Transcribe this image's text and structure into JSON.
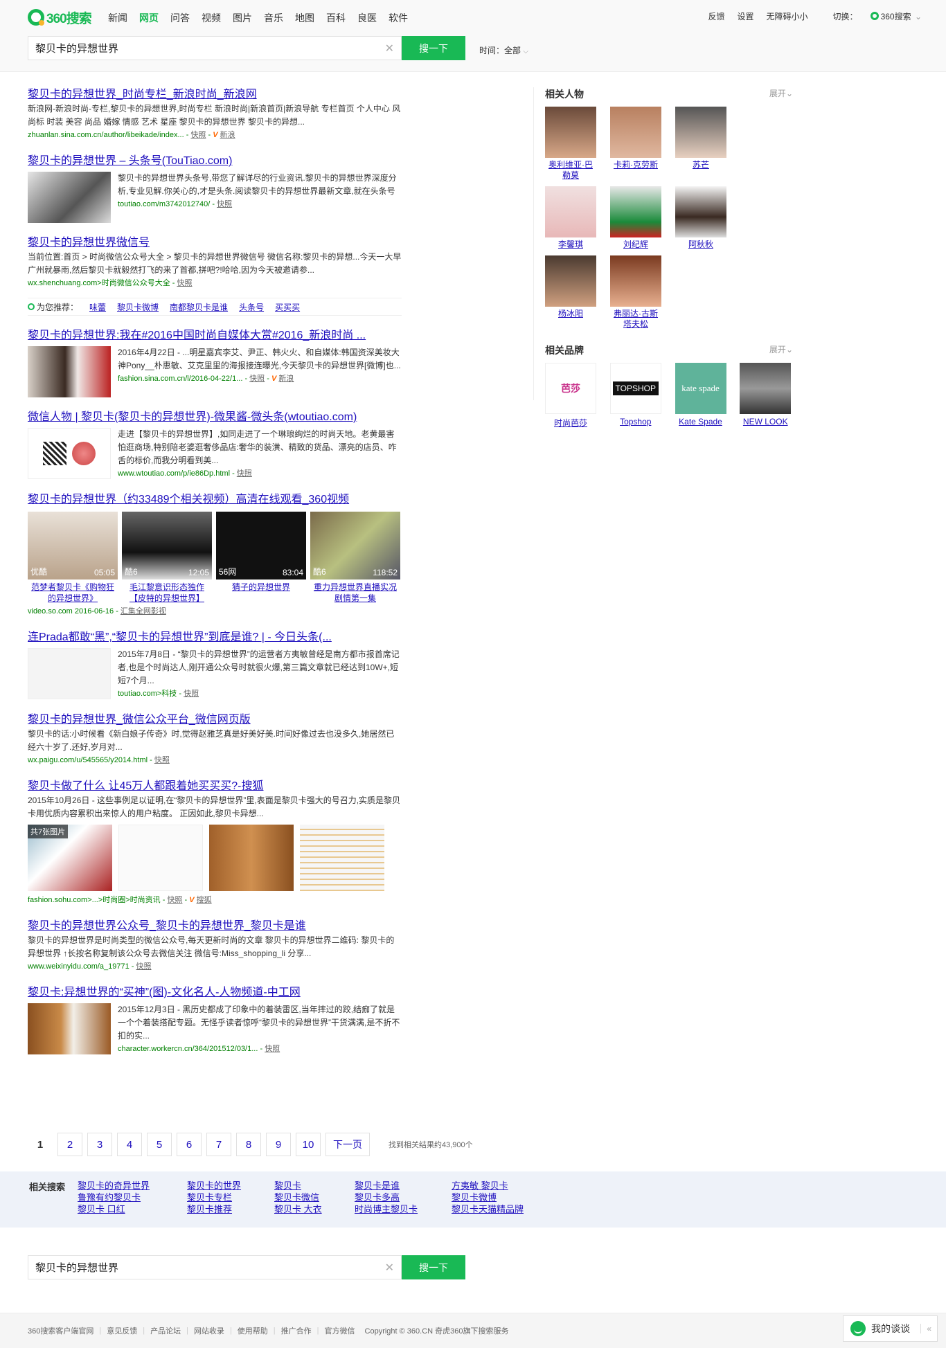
{
  "brand": {
    "name": "360搜索"
  },
  "nav": [
    "新闻",
    "网页",
    "问答",
    "视频",
    "图片",
    "音乐",
    "地图",
    "百科",
    "良医",
    "软件"
  ],
  "nav_active": "网页",
  "toplinks": {
    "feedback": "反馈",
    "settings": "设置",
    "barrier_free": "无障碍小小",
    "switch": "切换：",
    "switch_target": "360搜索"
  },
  "search": {
    "query": "黎贝卡的异想世界",
    "button": "搜一下",
    "time_label": "时间：",
    "time_value": "全部"
  },
  "results": [
    {
      "title": "黎贝卡的异想世界_时尚专栏_新浪时尚_新浪网",
      "desc": "新浪网-新浪时尚-专栏,黎贝卡的异想世界,时尚专栏 新浪时尚|新浪首页|新浪导航 专栏首页 个人中心 风尚标 时装 美容 尚品 婚嫁 情感 艺术 星座 黎贝卡的异想世界 黎贝卡的异想...",
      "url": "zhuanlan.sina.com.cn/author/libeikade/index...",
      "snap": "快照",
      "site": "新浪"
    },
    {
      "title": "黎贝卡的异想世界 – 头条号(TouTiao.com)",
      "desc": "黎贝卡的异想世界头条号,带您了解详尽的行业资讯.黎贝卡的异想世界深度分析,专业见解.你关心的,才是头条.阅读黎贝卡的异想世界最新文章,就在头条号",
      "url": "toutiao.com/m3742012740/",
      "snap": "快照"
    },
    {
      "title": "黎贝卡的异想世界微信号",
      "desc": "当前位置:首页 > 时尚微信公众号大全 > 黎贝卡的异想世界微信号 微信名称:黎贝卡的异想...今天一大早广州就暴雨,然后黎贝卡就毅然打飞的来了首都,拼吧?!哈哈,因为今天被邀请参...",
      "url": "wx.shenchuang.com>时尚微信公众号大全",
      "snap": "快照"
    },
    {
      "title": "黎贝卡的异想世界:我在#2016中国时尚自媒体大赏#2016_新浪时尚 ...",
      "desc": "2016年4月22日 - ...明星嘉宾李艾、尹正、韩火火、和自媒体:韩国资深美妆大神Pony__朴惠敏、艾克里里的海报接连曝光,今天黎贝卡的异想世界[微博]也...",
      "url": "fashion.sina.com.cn/l/2016-04-22/1...",
      "snap": "快照",
      "site": "新浪"
    },
    {
      "title": "微信人物 | 黎贝卡(黎贝卡的异想世界)-微果酱-微头条(wtoutiao.com)",
      "desc": "走进【黎贝卡的异想世界】,如同走进了一个琳琅绚烂的时尚天地。老黄最害怕逛商场,特别陪老婆逛奢侈品店:奢华的装潢、精致的货品、漂亮的店员、咋舌的标价,而我分明看到美...",
      "url": "www.wtoutiao.com/p/ie86Dp.html",
      "snap": "快照"
    },
    {
      "title": "黎贝卡的异想世界（约33489个相关视频）高清在线观看_360视频",
      "url": "video.so.com 2016-06-16",
      "snap": "汇集全网影视"
    },
    {
      "title": "连Prada都敢“黑”,“黎贝卡的异想世界”到底是谁? | - 今日头条(...",
      "desc": "2015年7月8日 - “黎贝卡的异想世界”的运营者方夷敏曾经是南方都市报首席记者,也是个时尚达人,刚开通公众号时就很火爆,第三篇文章就已经达到10W+,短短7个月...",
      "url": "toutiao.com>科技",
      "snap": "快照"
    },
    {
      "title": "黎贝卡的异想世界_微信公众平台_微信网页版",
      "desc": "黎贝卡的话:小时候看《新白娘子传奇》时,觉得赵雅芝真是好美好美.时间好像过去也没多久,她居然已经六十岁了.还好,岁月对...",
      "url": "wx.paigu.com/u/545565/y2014.html",
      "snap": "快照"
    },
    {
      "title": "黎贝卡做了什么 让45万人都跟着她买买买?-搜狐",
      "desc": "2015年10月26日 - 这些事例足以证明,在“黎贝卡的异想世界”里,表面是黎贝卡强大的号召力,实质是黎贝卡用优质内容累积出来惊人的用户粘度。 正因如此,黎贝卡异想...",
      "url": "fashion.sohu.com>...>时尚圈>时尚资讯",
      "snap": "快照",
      "site": "搜狐",
      "gallery_badge": "共7张图片"
    },
    {
      "title": "黎贝卡的异想世界公众号_黎贝卡的异想世界_黎贝卡是谁",
      "desc": "黎贝卡的异想世界是时尚类型的微信公众号,每天更新时尚的文章 黎贝卡的异想世界二维码: 黎贝卡的异想世界 ↑长按名称复制该公众号去微信关注 微信号:Miss_shopping_li 分享...",
      "url": "www.weixinyidu.com/a_19771",
      "snap": "快照"
    },
    {
      "title": "黎贝卡:异想世界的“买神”(图)-文化名人-人物频道-中工网",
      "desc": "2015年12月3日 - 黑历史都成了印象中的着装雷区,当年摔过的跤,结痂了就是一个个着装搭配专题。无怪乎读者惊呼“黎贝卡的异想世界”干货满满,是不折不扣的实...",
      "url": "character.workercn.cn/364/201512/03/1...",
      "snap": "快照"
    }
  ],
  "recommend": {
    "label": "为您推荐：",
    "items": [
      "味蕾",
      "黎贝卡微博",
      "南都黎贝卡是谁",
      "头条号",
      "买买买"
    ]
  },
  "videos": [
    {
      "src": "优酷",
      "dur": "05:05",
      "cap": "范梦者黎贝卡《购物狂的异想世界》"
    },
    {
      "src": "酷6",
      "dur": "12:05",
      "cap": "毛江黎意识形态独作【皮特的异想世界】"
    },
    {
      "src": "56网",
      "dur": "83:04",
      "cap": "猜子的异想世界"
    },
    {
      "src": "酷6",
      "dur": "118:52",
      "cap": "重力异想世界直播实况剧情第一集"
    }
  ],
  "pager": {
    "pages": [
      "1",
      "2",
      "3",
      "4",
      "5",
      "6",
      "7",
      "8",
      "9",
      "10"
    ],
    "next": "下一页",
    "total": "找到相关结果约43,900个"
  },
  "related": {
    "label": "相关搜索",
    "items": [
      "黎贝卡的奇异世界",
      "黎贝卡的世界",
      "黎贝卡",
      "黎贝卡是谁",
      "方夷敏 黎贝卡",
      "鲁豫有约黎贝卡",
      "黎贝卡专栏",
      "黎贝卡微信",
      "黎贝卡多高",
      "黎贝卡微博",
      "黎贝卡 口红",
      "黎贝卡推荐",
      "黎贝卡 大衣",
      "时尚博主黎贝卡",
      "黎贝卡天猫精品牌"
    ]
  },
  "sidebar": {
    "people_title": "相关人物",
    "expand": "展开",
    "people": [
      "奥利维亚·巴勒莫",
      "卡莉·克劳斯",
      "苏芒",
      "李馨琪",
      "刘纪辉",
      "阿秋秋",
      "杨冰阳",
      "弗丽达·古斯塔夫松"
    ],
    "brands_title": "相关品牌",
    "brands": [
      {
        "name": "时尚芭莎",
        "logo": "芭莎"
      },
      {
        "name": "Topshop",
        "logo": "TOPSHOP"
      },
      {
        "name": "Kate Spade",
        "logo": "kate spade"
      },
      {
        "name": "NEW LOOK",
        "logo": ""
      }
    ]
  },
  "footer": {
    "links": [
      "360搜索客户端官网",
      "意见反馈",
      "产品论坛",
      "网站收录",
      "使用帮助",
      "推广合作",
      "官方微信"
    ],
    "copyright": "Copyright © 360.CN 奇虎360旗下搜索服务"
  },
  "mytalk": {
    "label": "我的谈谈",
    "arrow": "«"
  }
}
